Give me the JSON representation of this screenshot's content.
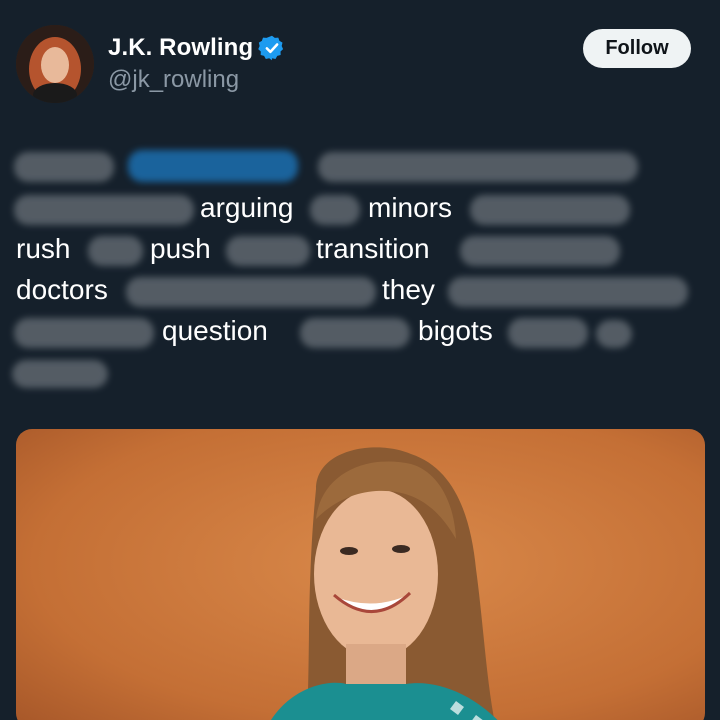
{
  "author": {
    "display_name": "J.K. Rowling",
    "handle": "@jk_rowling",
    "verified_icon": "verified-badge-icon",
    "avatar_icon": "profile-photo"
  },
  "follow_button": {
    "label": "Follow"
  },
  "tweet": {
    "visible_words": [
      "arguing",
      "minors",
      "rush",
      "push",
      "transition",
      "doctors",
      "they",
      "question",
      "bigots"
    ]
  },
  "media": {
    "image_icon": "woman-portrait-photo"
  },
  "colors": {
    "background": "#15202b",
    "verified_blue": "#1d9bf0",
    "follow_bg": "#eff3f4",
    "handle_gray": "#8b98a5",
    "photo_bg": "#c8743a"
  }
}
